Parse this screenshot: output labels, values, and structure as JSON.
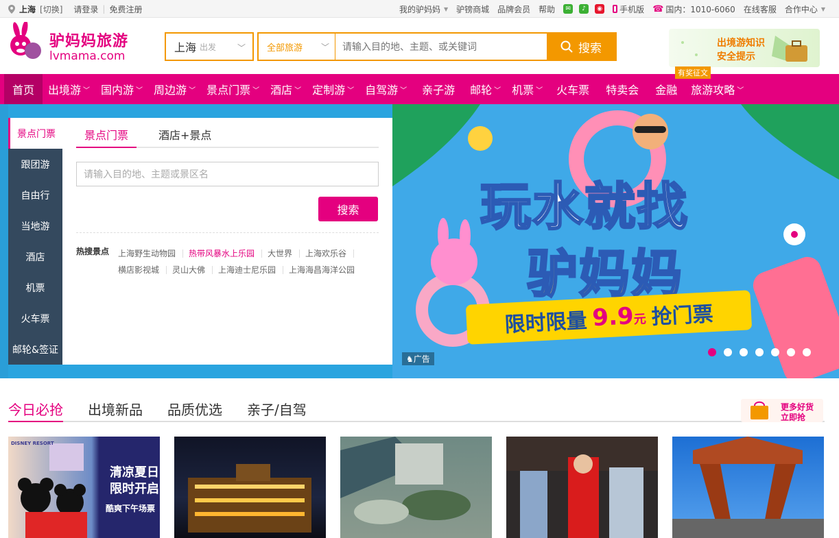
{
  "topbar": {
    "city": "上海",
    "switch": "[切换]",
    "login": "请登录",
    "register": "免费注册",
    "links": [
      "我的驴妈妈",
      "驴镑商城",
      "品牌会员",
      "帮助"
    ],
    "mobile": "手机版",
    "phone": "国内：1010-6060",
    "service": "在线客服",
    "partner": "合作中心"
  },
  "header": {
    "brand_cn": "驴妈妈旅游",
    "brand_en": "lvmama.com",
    "city": "上海",
    "city_sub": "出发",
    "category": "全部旅游",
    "search_placeholder": "请输入目的地、主题、或关键词",
    "search_button": "搜索",
    "promo_line1": "出境游知识",
    "promo_line2": "安全提示"
  },
  "nav": {
    "items": [
      "首页",
      "出境游",
      "国内游",
      "周边游",
      "景点门票",
      "酒店",
      "定制游",
      "自驾游",
      "亲子游",
      "邮轮",
      "机票",
      "火车票",
      "特卖会",
      "金融",
      "旅游攻略"
    ],
    "dropdown": [
      false,
      true,
      true,
      true,
      true,
      true,
      true,
      true,
      false,
      true,
      true,
      false,
      false,
      false,
      true
    ],
    "badge": "有奖征文"
  },
  "sidebar": {
    "items": [
      "景点门票",
      "跟团游",
      "自由行",
      "当地游",
      "酒店",
      "机票",
      "火车票",
      "邮轮&签证"
    ]
  },
  "panel": {
    "tabs": [
      "景点门票",
      "酒店+景点"
    ],
    "placeholder": "请输入目的地、主题或景区名",
    "search_button": "搜索",
    "hot_label": "热搜景点",
    "hot_links": [
      "上海野生动物园",
      "热带风暴水上乐园",
      "大世界",
      "上海欢乐谷",
      "横店影视城",
      "灵山大佛",
      "上海迪士尼乐园",
      "上海海昌海洋公园"
    ]
  },
  "banner": {
    "line1": "玩水就找",
    "line2": "驴妈妈",
    "ribbon_prefix": "限时限量",
    "price": "9.9",
    "unit": "元",
    "ribbon_suffix": "抢门票",
    "ad": "广告",
    "active_dot": 0,
    "dots": 7
  },
  "section": {
    "tabs": [
      "今日必抢",
      "出境新品",
      "品质优选",
      "亲子/自驾"
    ],
    "more_line1": "更多好货",
    "more_line2": "立即抢",
    "card1_line1": "清凉夏日",
    "card1_line2": "限时开启",
    "card1_line3": "酷爽下午场票",
    "card1_logo": "DISNEY RESORT"
  },
  "colors": {
    "brand": "#e4007f",
    "accent": "#f39800",
    "sidebar": "#34495e"
  }
}
